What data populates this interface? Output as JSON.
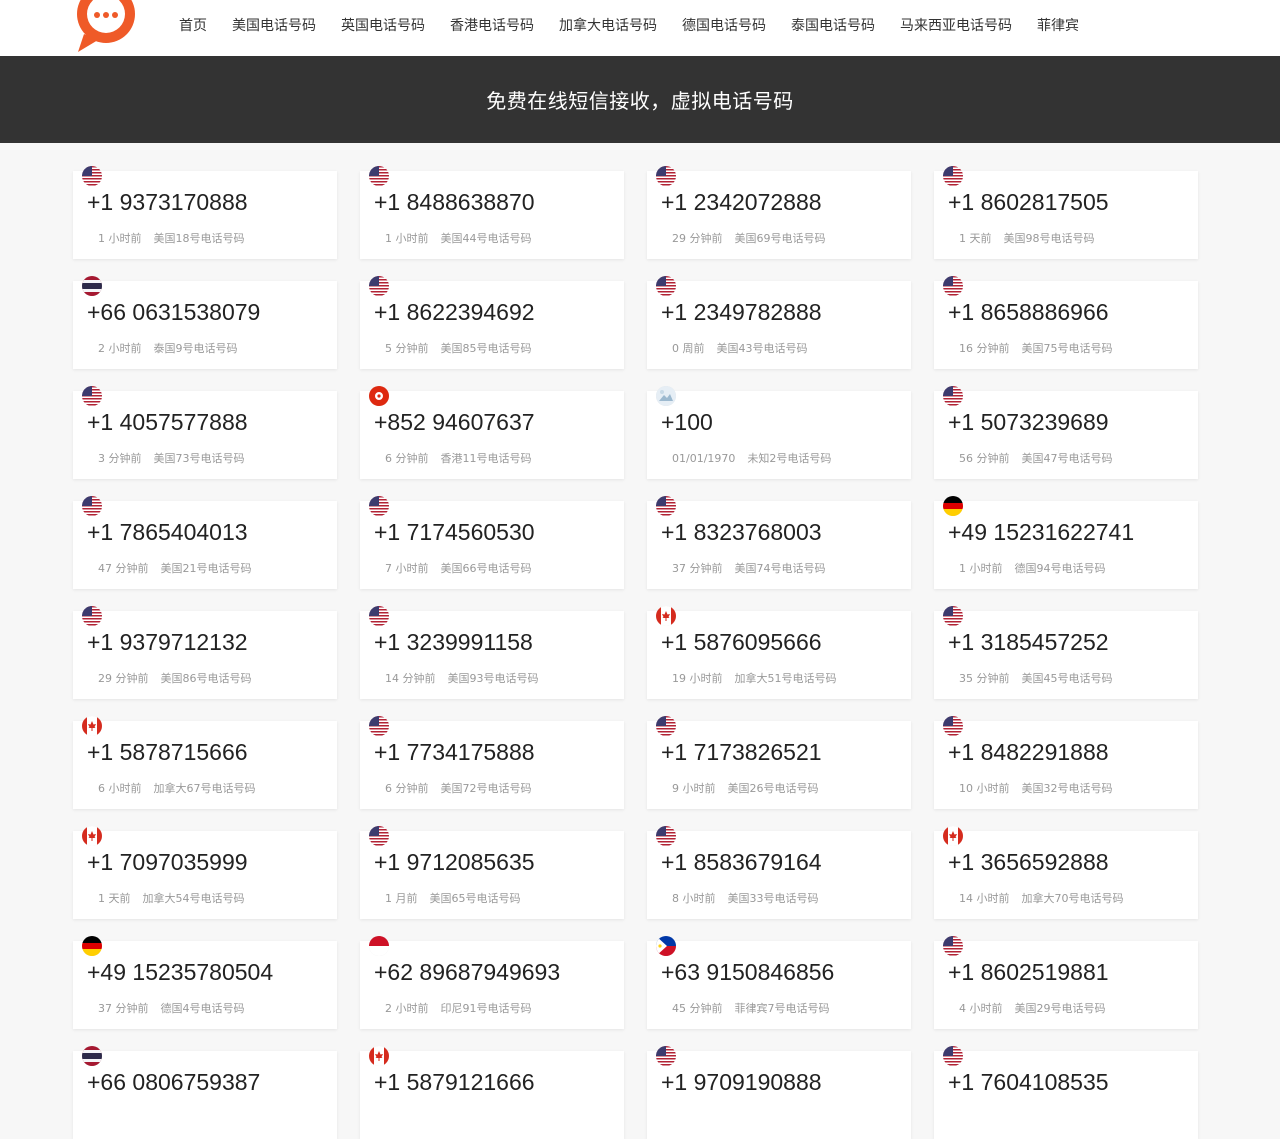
{
  "nav": {
    "items": [
      "首页",
      "美国电话号码",
      "英国电话号码",
      "香港电话号码",
      "加拿大电话号码",
      "德国电话号码",
      "泰国电话号码",
      "马来西亚电话号码",
      "菲律宾"
    ]
  },
  "hero": {
    "title": "免费在线短信接收，虚拟电话号码"
  },
  "colors": {
    "brand": "#ef5a28",
    "hero_bg": "#333333"
  },
  "cards": [
    {
      "flag": "us",
      "number": "+1 9373170888",
      "time": "1 小时前",
      "label": "美国18号电话号码"
    },
    {
      "flag": "us",
      "number": "+1 8488638870",
      "time": "1 小时前",
      "label": "美国44号电话号码"
    },
    {
      "flag": "us",
      "number": "+1 2342072888",
      "time": "29 分钟前",
      "label": "美国69号电话号码"
    },
    {
      "flag": "us",
      "number": "+1 8602817505",
      "time": "1 天前",
      "label": "美国98号电话号码"
    },
    {
      "flag": "th",
      "number": "+66 0631538079",
      "time": "2 小时前",
      "label": "泰国9号电话号码"
    },
    {
      "flag": "us",
      "number": "+1 8622394692",
      "time": "5 分钟前",
      "label": "美国85号电话号码"
    },
    {
      "flag": "us",
      "number": "+1 2349782888",
      "time": "0 周前",
      "label": "美国43号电话号码"
    },
    {
      "flag": "us",
      "number": "+1 8658886966",
      "time": "16 分钟前",
      "label": "美国75号电话号码"
    },
    {
      "flag": "us",
      "number": "+1 4057577888",
      "time": "3 分钟前",
      "label": "美国73号电话号码"
    },
    {
      "flag": "hk",
      "number": "+852 94607637",
      "time": "6 分钟前",
      "label": "香港11号电话号码"
    },
    {
      "flag": "none",
      "number": "+100",
      "time": "01/01/1970",
      "label": "未知2号电话号码"
    },
    {
      "flag": "us",
      "number": "+1 5073239689",
      "time": "56 分钟前",
      "label": "美国47号电话号码"
    },
    {
      "flag": "us",
      "number": "+1 7865404013",
      "time": "47 分钟前",
      "label": "美国21号电话号码"
    },
    {
      "flag": "us",
      "number": "+1 7174560530",
      "time": "7 小时前",
      "label": "美国66号电话号码"
    },
    {
      "flag": "us",
      "number": "+1 8323768003",
      "time": "37 分钟前",
      "label": "美国74号电话号码"
    },
    {
      "flag": "de",
      "number": "+49 15231622741",
      "time": "1 小时前",
      "label": "德国94号电话号码"
    },
    {
      "flag": "us",
      "number": "+1 9379712132",
      "time": "29 分钟前",
      "label": "美国86号电话号码"
    },
    {
      "flag": "us",
      "number": "+1 3239991158",
      "time": "14 分钟前",
      "label": "美国93号电话号码"
    },
    {
      "flag": "ca",
      "number": "+1 5876095666",
      "time": "19 小时前",
      "label": "加拿大51号电话号码"
    },
    {
      "flag": "us",
      "number": "+1 3185457252",
      "time": "35 分钟前",
      "label": "美国45号电话号码"
    },
    {
      "flag": "ca",
      "number": "+1 5878715666",
      "time": "6 小时前",
      "label": "加拿大67号电话号码"
    },
    {
      "flag": "us",
      "number": "+1 7734175888",
      "time": "6 分钟前",
      "label": "美国72号电话号码"
    },
    {
      "flag": "us",
      "number": "+1 7173826521",
      "time": "9 小时前",
      "label": "美国26号电话号码"
    },
    {
      "flag": "us",
      "number": "+1 8482291888",
      "time": "10 小时前",
      "label": "美国32号电话号码"
    },
    {
      "flag": "ca",
      "number": "+1 7097035999",
      "time": "1 天前",
      "label": "加拿大54号电话号码"
    },
    {
      "flag": "us",
      "number": "+1 9712085635",
      "time": "1 月前",
      "label": "美国65号电话号码"
    },
    {
      "flag": "us",
      "number": "+1 8583679164",
      "time": "8 小时前",
      "label": "美国33号电话号码"
    },
    {
      "flag": "ca",
      "number": "+1 3656592888",
      "time": "14 小时前",
      "label": "加拿大70号电话号码"
    },
    {
      "flag": "de",
      "number": "+49 15235780504",
      "time": "37 分钟前",
      "label": "德国4号电话号码"
    },
    {
      "flag": "id",
      "number": "+62 89687949693",
      "time": "2 小时前",
      "label": "印尼91号电话号码"
    },
    {
      "flag": "ph",
      "number": "+63 9150846856",
      "time": "45 分钟前",
      "label": "菲律宾7号电话号码"
    },
    {
      "flag": "us",
      "number": "+1 8602519881",
      "time": "4 小时前",
      "label": "美国29号电话号码"
    },
    {
      "flag": "th",
      "number": "+66 0806759387",
      "time": "",
      "label": ""
    },
    {
      "flag": "ca",
      "number": "+1 5879121666",
      "time": "",
      "label": ""
    },
    {
      "flag": "us",
      "number": "+1 9709190888",
      "time": "",
      "label": ""
    },
    {
      "flag": "us",
      "number": "+1 7604108535",
      "time": "",
      "label": ""
    }
  ]
}
